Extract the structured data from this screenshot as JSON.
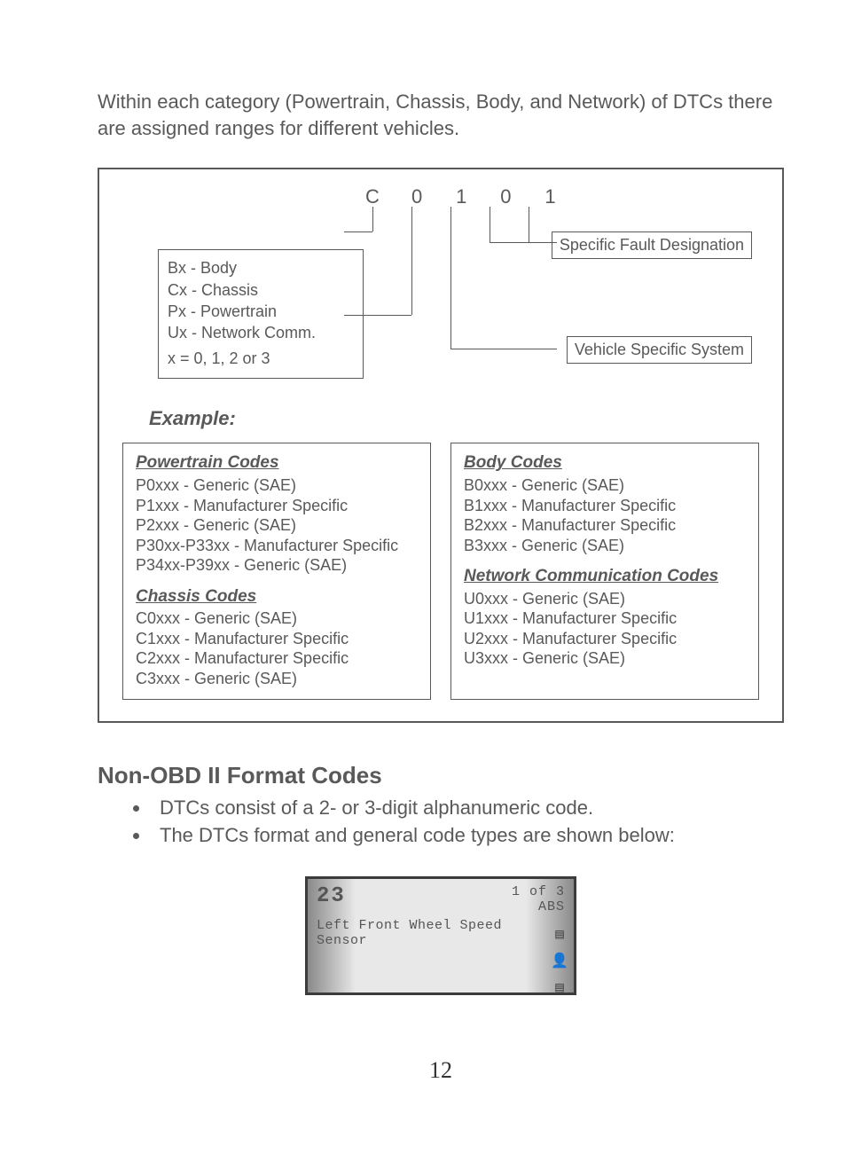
{
  "intro": "Within each category (Powertrain, Chassis, Body, and Network) of DTCs there are assigned ranges for different vehicles.",
  "code_digits": [
    "C",
    "0",
    "1",
    "0",
    "1"
  ],
  "prefix_box": [
    "Bx - Body",
    "Cx - Chassis",
    "Px - Powertrain",
    "Ux - Network Comm.",
    "x = 0, 1, 2 or 3"
  ],
  "fault_label": "Specific Fault Designation",
  "system_label": "Vehicle Specific System",
  "example_label": "Example:",
  "powertrain": {
    "title": "Powertrain Codes",
    "items": [
      "P0xxx - Generic (SAE)",
      "P1xxx - Manufacturer Specific",
      "P2xxx - Generic (SAE)",
      "P30xx-P33xx - Manufacturer Specific",
      "P34xx-P39xx - Generic (SAE)"
    ]
  },
  "chassis": {
    "title": "Chassis Codes",
    "items": [
      "C0xxx - Generic (SAE)",
      "C1xxx - Manufacturer Specific",
      "C2xxx - Manufacturer Specific",
      "C3xxx - Generic (SAE)"
    ]
  },
  "body": {
    "title": "Body Codes",
    "items": [
      "B0xxx - Generic (SAE)",
      "B1xxx - Manufacturer Specific",
      "B2xxx - Manufacturer Specific",
      "B3xxx - Generic (SAE)"
    ]
  },
  "network": {
    "title": "Network Communication Codes",
    "items": [
      "U0xxx - Generic (SAE)",
      "U1xxx - Manufacturer Specific",
      "U2xxx - Manufacturer Specific",
      "U3xxx - Generic (SAE)"
    ]
  },
  "section_heading": "Non-OBD II Format Codes",
  "bullets": [
    "DTCs consist of a 2- or 3-digit alphanumeric code.",
    "The DTCs format and general code types are shown below:"
  ],
  "scantool": {
    "code": "23",
    "position": "1 of 3",
    "module": "ABS",
    "description_line1": "Left Front Wheel Speed",
    "description_line2": "Sensor"
  },
  "page_number": "12"
}
